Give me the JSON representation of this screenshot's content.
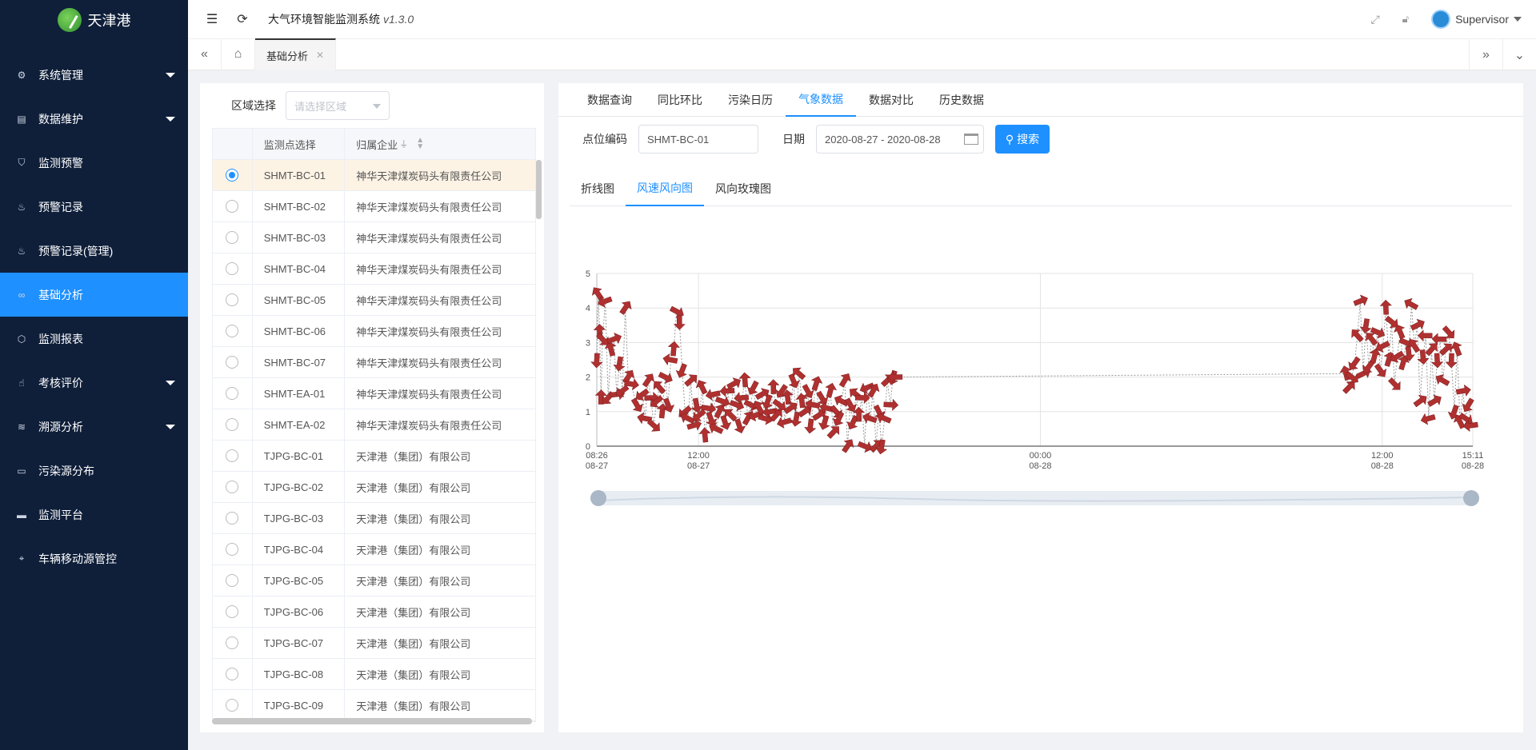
{
  "app": {
    "logo_text": "天津港",
    "title": "大气环境智能监测系统",
    "version": "v1.3.0",
    "user": "Supervisor"
  },
  "sidebar": {
    "items": [
      {
        "label": "系统管理",
        "icon": "gear-icon",
        "has_caret": true
      },
      {
        "label": "数据维护",
        "icon": "database-icon",
        "has_caret": true
      },
      {
        "label": "监测预警",
        "icon": "shield-icon",
        "has_caret": false
      },
      {
        "label": "预警记录",
        "icon": "fire-icon",
        "has_caret": false
      },
      {
        "label": "预警记录(管理)",
        "icon": "fire-icon",
        "has_caret": false
      },
      {
        "label": "基础分析",
        "icon": "link-icon",
        "has_caret": false,
        "active": true
      },
      {
        "label": "监测报表",
        "icon": "cube-icon",
        "has_caret": false
      },
      {
        "label": "考核评价",
        "icon": "thumb-icon",
        "has_caret": true
      },
      {
        "label": "溯源分析",
        "icon": "layers-icon",
        "has_caret": true
      },
      {
        "label": "污染源分布",
        "icon": "image-icon",
        "has_caret": false
      },
      {
        "label": "监测平台",
        "icon": "monitor-icon",
        "has_caret": false
      },
      {
        "label": "车辆移动源管控",
        "icon": "location-icon",
        "has_caret": false
      }
    ]
  },
  "tabs": {
    "active_label": "基础分析"
  },
  "left": {
    "region_label": "区域选择",
    "region_placeholder": "请选择区域",
    "columns": [
      "监测点选择",
      "归属企业"
    ],
    "rows": [
      {
        "code": "SHMT-BC-01",
        "company": "神华天津煤炭码头有限责任公司",
        "selected": true
      },
      {
        "code": "SHMT-BC-02",
        "company": "神华天津煤炭码头有限责任公司"
      },
      {
        "code": "SHMT-BC-03",
        "company": "神华天津煤炭码头有限责任公司"
      },
      {
        "code": "SHMT-BC-04",
        "company": "神华天津煤炭码头有限责任公司"
      },
      {
        "code": "SHMT-BC-05",
        "company": "神华天津煤炭码头有限责任公司"
      },
      {
        "code": "SHMT-BC-06",
        "company": "神华天津煤炭码头有限责任公司"
      },
      {
        "code": "SHMT-BC-07",
        "company": "神华天津煤炭码头有限责任公司"
      },
      {
        "code": "SHMT-EA-01",
        "company": "神华天津煤炭码头有限责任公司"
      },
      {
        "code": "SHMT-EA-02",
        "company": "神华天津煤炭码头有限责任公司"
      },
      {
        "code": "TJPG-BC-01",
        "company": "天津港（集团）有限公司"
      },
      {
        "code": "TJPG-BC-02",
        "company": "天津港（集团）有限公司"
      },
      {
        "code": "TJPG-BC-03",
        "company": "天津港（集团）有限公司"
      },
      {
        "code": "TJPG-BC-04",
        "company": "天津港（集团）有限公司"
      },
      {
        "code": "TJPG-BC-05",
        "company": "天津港（集团）有限公司"
      },
      {
        "code": "TJPG-BC-06",
        "company": "天津港（集团）有限公司"
      },
      {
        "code": "TJPG-BC-07",
        "company": "天津港（集团）有限公司"
      },
      {
        "code": "TJPG-BC-08",
        "company": "天津港（集团）有限公司"
      },
      {
        "code": "TJPG-BC-09",
        "company": "天津港（集团）有限公司"
      }
    ]
  },
  "right": {
    "tabs": [
      "数据查询",
      "同比环比",
      "污染日历",
      "气象数据",
      "数据对比",
      "历史数据"
    ],
    "active_tab": 3,
    "point_label": "点位编码",
    "point_value": "SHMT-BC-01",
    "date_label": "日期",
    "date_value": "2020-08-27 - 2020-08-28",
    "search_label": "搜索",
    "subtabs": [
      "折线图",
      "风速风向图",
      "风向玫瑰图"
    ],
    "active_subtab": 1
  },
  "chart_data": {
    "type": "line",
    "x_range_hours": [
      0,
      30.75
    ],
    "ylim": [
      0,
      5
    ],
    "y_ticks": [
      0,
      1,
      2,
      3,
      4,
      5
    ],
    "x_ticks": [
      {
        "line1": "08:26",
        "line2": "08-27"
      },
      {
        "line1": "12:00",
        "line2": "08-27"
      },
      {
        "line1": "00:00",
        "line2": "08-28"
      },
      {
        "line1": "12:00",
        "line2": "08-28"
      },
      {
        "line1": "15:11",
        "line2": "08-28"
      }
    ],
    "x_tick_hours": [
      0,
      3.57,
      15.57,
      27.57,
      30.75
    ],
    "grid": true,
    "arrow_color": "#b03030",
    "series": [
      {
        "name": "",
        "points": [
          [
            0.0,
            2.5
          ],
          [
            0.05,
            4.4
          ],
          [
            0.1,
            3.3
          ],
          [
            0.15,
            1.4
          ],
          [
            0.2,
            3.1
          ],
          [
            0.3,
            4.2
          ],
          [
            0.4,
            1.4
          ],
          [
            0.5,
            2.8
          ],
          [
            0.6,
            3.1
          ],
          [
            0.7,
            1.5
          ],
          [
            0.8,
            2.4
          ],
          [
            0.9,
            1.6
          ],
          [
            1.0,
            4.0
          ],
          [
            1.1,
            2.0
          ],
          [
            1.2,
            1.8
          ],
          [
            1.4,
            1.2
          ],
          [
            1.6,
            1.5
          ],
          [
            1.7,
            0.8
          ],
          [
            1.8,
            1.9
          ],
          [
            1.9,
            1.4
          ],
          [
            2.0,
            0.6
          ],
          [
            2.1,
            1.3
          ],
          [
            2.2,
            1.7
          ],
          [
            2.3,
            1.0
          ],
          [
            2.4,
            2.0
          ],
          [
            2.5,
            1.2
          ],
          [
            2.6,
            2.5
          ],
          [
            2.7,
            2.8
          ],
          [
            2.8,
            3.9
          ],
          [
            2.9,
            3.6
          ],
          [
            3.0,
            2.2
          ],
          [
            3.1,
            1.0
          ],
          [
            3.2,
            0.8
          ],
          [
            3.3,
            1.9
          ],
          [
            3.4,
            0.6
          ],
          [
            3.5,
            1.2
          ],
          [
            3.6,
            0.9
          ],
          [
            3.7,
            1.7
          ],
          [
            3.8,
            0.3
          ],
          [
            3.9,
            1.1
          ],
          [
            4.0,
            0.8
          ],
          [
            4.1,
            1.5
          ],
          [
            4.2,
            0.5
          ],
          [
            4.3,
            1.0
          ],
          [
            4.4,
            1.3
          ],
          [
            4.5,
            0.7
          ],
          [
            4.6,
            1.6
          ],
          [
            4.7,
            0.9
          ],
          [
            4.8,
            1.8
          ],
          [
            4.9,
            1.2
          ],
          [
            5.0,
            0.6
          ],
          [
            5.1,
            1.4
          ],
          [
            5.2,
            1.9
          ],
          [
            5.3,
            0.8
          ],
          [
            5.4,
            1.2
          ],
          [
            5.5,
            1.7
          ],
          [
            5.6,
            0.9
          ],
          [
            5.7,
            1.1
          ],
          [
            5.8,
            1.5
          ],
          [
            5.9,
            0.8
          ],
          [
            6.0,
            1.3
          ],
          [
            6.1,
            1.0
          ],
          [
            6.2,
            1.7
          ],
          [
            6.3,
            0.9
          ],
          [
            6.4,
            1.2
          ],
          [
            6.5,
            1.6
          ],
          [
            6.6,
            0.7
          ],
          [
            6.7,
            1.4
          ],
          [
            6.8,
            1.1
          ],
          [
            6.9,
            1.9
          ],
          [
            7.0,
            0.8
          ],
          [
            7.1,
            2.1
          ],
          [
            7.2,
            1.3
          ],
          [
            7.3,
            1.0
          ],
          [
            7.4,
            1.6
          ],
          [
            7.5,
            0.6
          ],
          [
            7.6,
            1.2
          ],
          [
            7.7,
            1.8
          ],
          [
            7.8,
            0.9
          ],
          [
            7.9,
            1.4
          ],
          [
            8.0,
            0.7
          ],
          [
            8.1,
            1.1
          ],
          [
            8.2,
            1.6
          ],
          [
            8.3,
            0.4
          ],
          [
            8.4,
            1.0
          ],
          [
            8.5,
            0.8
          ],
          [
            8.6,
            1.3
          ],
          [
            8.7,
            1.9
          ],
          [
            8.8,
            0.0
          ],
          [
            8.9,
            1.2
          ],
          [
            9.0,
            0.7
          ],
          [
            9.1,
            1.5
          ],
          [
            9.2,
            0.9
          ],
          [
            9.3,
            1.4
          ],
          [
            9.4,
            0.0
          ],
          [
            9.5,
            1.7
          ],
          [
            9.6,
            0.8
          ],
          [
            9.7,
            1.6
          ],
          [
            9.8,
            0.0
          ],
          [
            9.9,
            1.0
          ],
          [
            10.0,
            0.0
          ],
          [
            10.1,
            0.8
          ],
          [
            10.2,
            1.9
          ],
          [
            10.3,
            1.2
          ],
          [
            10.4,
            2.0
          ],
          [
            10.5,
            2.0
          ],
          [
            26.3,
            2.1
          ],
          [
            26.4,
            1.7
          ],
          [
            26.5,
            2.0
          ],
          [
            26.6,
            2.4
          ],
          [
            26.7,
            3.2
          ],
          [
            26.8,
            4.2
          ],
          [
            26.9,
            2.1
          ],
          [
            27.0,
            3.5
          ],
          [
            27.1,
            2.3
          ],
          [
            27.2,
            3.1
          ],
          [
            27.3,
            2.6
          ],
          [
            27.4,
            3.3
          ],
          [
            27.5,
            2.2
          ],
          [
            27.6,
            2.9
          ],
          [
            27.7,
            4.0
          ],
          [
            27.8,
            2.5
          ],
          [
            27.9,
            3.6
          ],
          [
            28.0,
            1.8
          ],
          [
            28.1,
            2.6
          ],
          [
            28.2,
            3.3
          ],
          [
            28.3,
            2.4
          ],
          [
            28.4,
            3.0
          ],
          [
            28.5,
            2.7
          ],
          [
            28.6,
            4.1
          ],
          [
            28.7,
            2.9
          ],
          [
            28.8,
            3.5
          ],
          [
            28.9,
            1.3
          ],
          [
            29.0,
            2.6
          ],
          [
            29.1,
            3.2
          ],
          [
            29.2,
            0.8
          ],
          [
            29.3,
            2.8
          ],
          [
            29.4,
            1.3
          ],
          [
            29.5,
            2.5
          ],
          [
            29.6,
            3.1
          ],
          [
            29.7,
            1.9
          ],
          [
            29.8,
            2.8
          ],
          [
            29.9,
            3.3
          ],
          [
            30.0,
            2.5
          ],
          [
            30.1,
            1.0
          ],
          [
            30.2,
            2.8
          ],
          [
            30.3,
            0.7
          ],
          [
            30.4,
            1.6
          ],
          [
            30.5,
            0.8
          ],
          [
            30.6,
            1.2
          ],
          [
            30.7,
            0.6
          ]
        ]
      }
    ]
  }
}
